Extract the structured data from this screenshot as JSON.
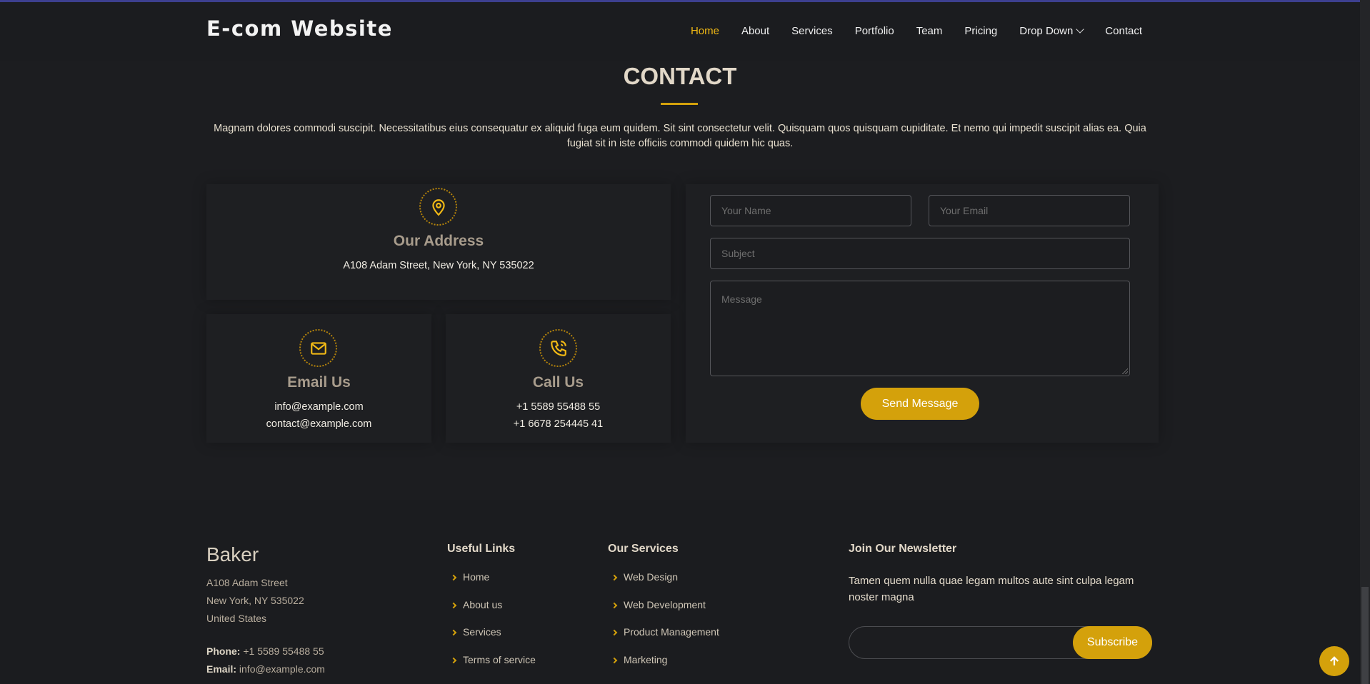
{
  "header": {
    "logo": "E-com Website",
    "nav": [
      {
        "label": "Home",
        "active": true
      },
      {
        "label": "About"
      },
      {
        "label": "Services"
      },
      {
        "label": "Portfolio"
      },
      {
        "label": "Team"
      },
      {
        "label": "Pricing"
      },
      {
        "label": "Drop Down"
      },
      {
        "label": "Contact"
      }
    ]
  },
  "contact": {
    "title": "CONTACT",
    "intro": "Magnam dolores commodi suscipit. Necessitatibus eius consequatur ex aliquid fuga eum quidem. Sit sint consectetur velit. Quisquam quos quisquam cupiditate. Et nemo qui impedit suscipit alias ea. Quia fugiat sit in iste officiis commodi quidem hic quas.",
    "address": {
      "title": "Our Address",
      "text": "A108 Adam Street, New York, NY 535022"
    },
    "email": {
      "title": "Email Us",
      "line1": "info@example.com",
      "line2": "contact@example.com"
    },
    "call": {
      "title": "Call Us",
      "line1": "+1 5589 55488 55",
      "line2": "+1 6678 254445 41"
    },
    "form": {
      "name_placeholder": "Your Name",
      "email_placeholder": "Your Email",
      "subject_placeholder": "Subject",
      "message_placeholder": "Message",
      "send_label": "Send Message"
    }
  },
  "footer": {
    "brand": "Baker",
    "address_lines": [
      "A108 Adam Street",
      "New York, NY 535022",
      "United States"
    ],
    "phone_label": "Phone:",
    "phone": "+1 5589 55488 55",
    "email_label": "Email:",
    "email": "info@example.com",
    "useful_links": {
      "title": "Useful Links",
      "items": [
        "Home",
        "About us",
        "Services",
        "Terms of service"
      ]
    },
    "services": {
      "title": "Our Services",
      "items": [
        "Web Design",
        "Web Development",
        "Product Management",
        "Marketing"
      ]
    },
    "newsletter": {
      "title": "Join Our Newsletter",
      "text": "Tamen quem nulla quae legam multos aute sint culpa legam noster magna",
      "subscribe_label": "Subscribe"
    }
  },
  "colors": {
    "accent": "#d4a10b",
    "background": "#1c1d20"
  }
}
